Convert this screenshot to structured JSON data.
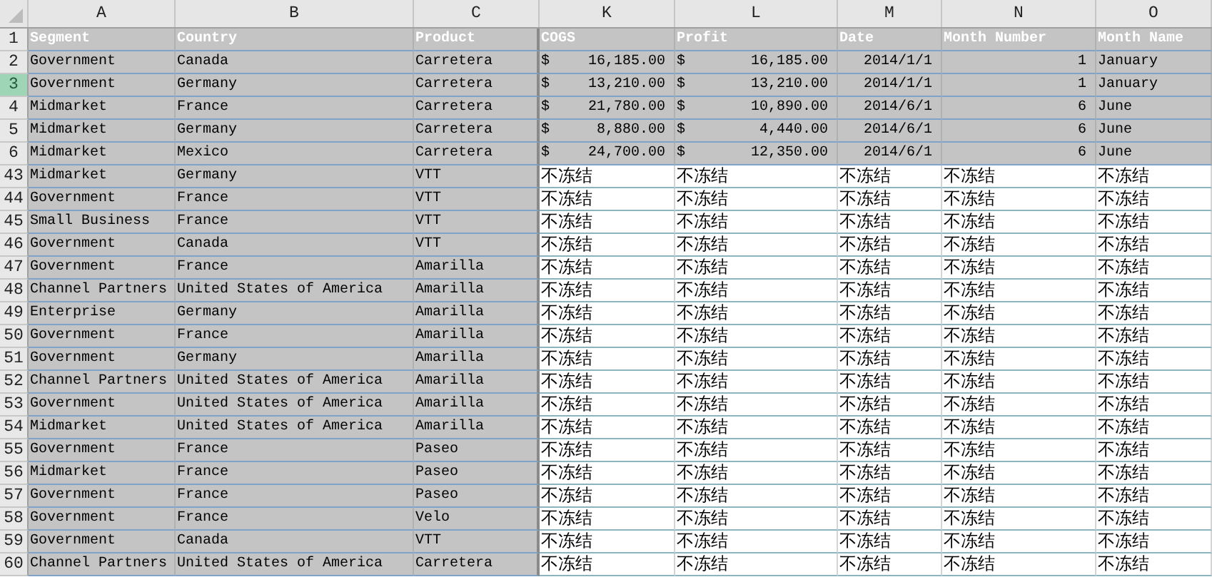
{
  "columns": [
    "A",
    "B",
    "C",
    "K",
    "L",
    "M",
    "N",
    "O"
  ],
  "rows": [
    {
      "number": "1",
      "selected": false,
      "kind": "header",
      "cells": [
        "Segment",
        "Country",
        "Product",
        "COGS",
        "Profit",
        "Date",
        "Month Number",
        "Month Name"
      ]
    },
    {
      "number": "2",
      "selected": false,
      "kind": "data",
      "cells": [
        "Government",
        "Canada",
        "Carretera",
        {
          "kind": "money",
          "symbol": "$",
          "amount": "16,185.00"
        },
        {
          "kind": "money",
          "symbol": "$",
          "amount": "16,185.00"
        },
        {
          "kind": "number",
          "text": "2014/1/1"
        },
        {
          "kind": "number",
          "text": "1"
        },
        "January"
      ]
    },
    {
      "number": "3",
      "selected": true,
      "kind": "data",
      "cells": [
        "Government",
        "Germany",
        "Carretera",
        {
          "kind": "money",
          "symbol": "$",
          "amount": "13,210.00"
        },
        {
          "kind": "money",
          "symbol": "$",
          "amount": "13,210.00"
        },
        {
          "kind": "number",
          "text": "2014/1/1"
        },
        {
          "kind": "number",
          "text": "1"
        },
        "January"
      ]
    },
    {
      "number": "4",
      "selected": false,
      "kind": "data",
      "cells": [
        "Midmarket",
        "France",
        "Carretera",
        {
          "kind": "money",
          "symbol": "$",
          "amount": "21,780.00"
        },
        {
          "kind": "money",
          "symbol": "$",
          "amount": "10,890.00"
        },
        {
          "kind": "number",
          "text": "2014/6/1"
        },
        {
          "kind": "number",
          "text": "6"
        },
        "June"
      ]
    },
    {
      "number": "5",
      "selected": false,
      "kind": "data",
      "cells": [
        "Midmarket",
        "Germany",
        "Carretera",
        {
          "kind": "money",
          "symbol": "$",
          "amount": "8,880.00"
        },
        {
          "kind": "money",
          "symbol": "$",
          "amount": "4,440.00"
        },
        {
          "kind": "number",
          "text": "2014/6/1"
        },
        {
          "kind": "number",
          "text": "6"
        },
        "June"
      ]
    },
    {
      "number": "6",
      "selected": false,
      "kind": "data",
      "cells": [
        "Midmarket",
        "Mexico",
        "Carretera",
        {
          "kind": "money",
          "symbol": "$",
          "amount": "24,700.00"
        },
        {
          "kind": "money",
          "symbol": "$",
          "amount": "12,350.00"
        },
        {
          "kind": "number",
          "text": "2014/6/1"
        },
        {
          "kind": "number",
          "text": "6"
        },
        "June"
      ]
    },
    {
      "number": "43",
      "selected": false,
      "kind": "split",
      "cells": [
        "Midmarket",
        "Germany",
        "VTT",
        "不冻结",
        "不冻结",
        "不冻结",
        "不冻结",
        "不冻结"
      ]
    },
    {
      "number": "44",
      "selected": false,
      "kind": "split",
      "cells": [
        "Government",
        "France",
        "VTT",
        "不冻结",
        "不冻结",
        "不冻结",
        "不冻结",
        "不冻结"
      ]
    },
    {
      "number": "45",
      "selected": false,
      "kind": "split",
      "cells": [
        "Small Business",
        "France",
        "VTT",
        "不冻结",
        "不冻结",
        "不冻结",
        "不冻结",
        "不冻结"
      ]
    },
    {
      "number": "46",
      "selected": false,
      "kind": "split",
      "cells": [
        "Government",
        "Canada",
        "VTT",
        "不冻结",
        "不冻结",
        "不冻结",
        "不冻结",
        "不冻结"
      ]
    },
    {
      "number": "47",
      "selected": false,
      "kind": "split",
      "cells": [
        "Government",
        "France",
        "Amarilla",
        "不冻结",
        "不冻结",
        "不冻结",
        "不冻结",
        "不冻结"
      ]
    },
    {
      "number": "48",
      "selected": false,
      "kind": "split",
      "cells": [
        "Channel Partners",
        "United States of America",
        "Amarilla",
        "不冻结",
        "不冻结",
        "不冻结",
        "不冻结",
        "不冻结"
      ]
    },
    {
      "number": "49",
      "selected": false,
      "kind": "split",
      "cells": [
        "Enterprise",
        "Germany",
        "Amarilla",
        "不冻结",
        "不冻结",
        "不冻结",
        "不冻结",
        "不冻结"
      ]
    },
    {
      "number": "50",
      "selected": false,
      "kind": "split",
      "cells": [
        "Government",
        "France",
        "Amarilla",
        "不冻结",
        "不冻结",
        "不冻结",
        "不冻结",
        "不冻结"
      ]
    },
    {
      "number": "51",
      "selected": false,
      "kind": "split",
      "cells": [
        "Government",
        "Germany",
        "Amarilla",
        "不冻结",
        "不冻结",
        "不冻结",
        "不冻结",
        "不冻结"
      ]
    },
    {
      "number": "52",
      "selected": false,
      "kind": "split",
      "cells": [
        "Channel Partners",
        "United States of America",
        "Amarilla",
        "不冻结",
        "不冻结",
        "不冻结",
        "不冻结",
        "不冻结"
      ]
    },
    {
      "number": "53",
      "selected": false,
      "kind": "split",
      "cells": [
        "Government",
        "United States of America",
        "Amarilla",
        "不冻结",
        "不冻结",
        "不冻结",
        "不冻结",
        "不冻结"
      ]
    },
    {
      "number": "54",
      "selected": false,
      "kind": "split",
      "cells": [
        "Midmarket",
        "United States of America",
        "Amarilla",
        "不冻结",
        "不冻结",
        "不冻结",
        "不冻结",
        "不冻结"
      ]
    },
    {
      "number": "55",
      "selected": false,
      "kind": "split",
      "cells": [
        "Government",
        "France",
        "Paseo",
        "不冻结",
        "不冻结",
        "不冻结",
        "不冻结",
        "不冻结"
      ]
    },
    {
      "number": "56",
      "selected": false,
      "kind": "split",
      "cells": [
        "Midmarket",
        "France",
        "Paseo",
        "不冻结",
        "不冻结",
        "不冻结",
        "不冻结",
        "不冻结"
      ]
    },
    {
      "number": "57",
      "selected": false,
      "kind": "split",
      "cells": [
        "Government",
        "France",
        "Paseo",
        "不冻结",
        "不冻结",
        "不冻结",
        "不冻结",
        "不冻结"
      ]
    },
    {
      "number": "58",
      "selected": false,
      "kind": "split",
      "cells": [
        "Government",
        "France",
        "Velo",
        "不冻结",
        "不冻结",
        "不冻结",
        "不冻结",
        "不冻结"
      ]
    },
    {
      "number": "59",
      "selected": false,
      "kind": "split",
      "cells": [
        "Government",
        "Canada",
        "VTT",
        "不冻结",
        "不冻结",
        "不冻结",
        "不冻结",
        "不冻结"
      ]
    },
    {
      "number": "60",
      "selected": false,
      "kind": "split",
      "cells": [
        "Channel Partners",
        "United States of America",
        "Carretera",
        "不冻结",
        "不冻结",
        "不冻结",
        "不冻结",
        "不冻结"
      ]
    }
  ]
}
